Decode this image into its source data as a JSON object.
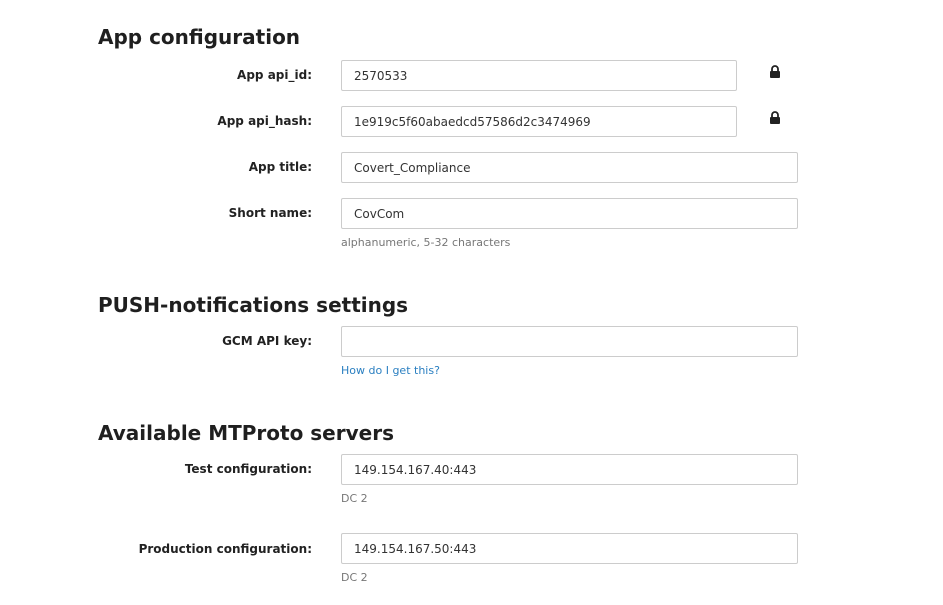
{
  "app_config": {
    "title": "App configuration",
    "api_id": {
      "label": "App api_id:",
      "value": "2570533",
      "locked_icon": "lock-icon"
    },
    "api_hash": {
      "label": "App api_hash:",
      "value": "1e919c5f60abaedcd57586d2c3474969",
      "locked_icon": "lock-icon"
    },
    "app_title": {
      "label": "App title:",
      "value": "Covert_Compliance"
    },
    "short_name": {
      "label": "Short name:",
      "value": "CovCom",
      "hint": "alphanumeric, 5-32 characters"
    }
  },
  "push": {
    "title": "PUSH-notifications settings",
    "gcm_key": {
      "label": "GCM API key:",
      "value": "",
      "help_link": "How do I get this?"
    }
  },
  "mtproto": {
    "title": "Available MTProto servers",
    "test": {
      "label": "Test configuration:",
      "value": "149.154.167.40:443",
      "dc": "DC 2"
    },
    "production": {
      "label": "Production configuration:",
      "value": "149.154.167.50:443",
      "dc": "DC 2"
    }
  },
  "colors": {
    "link": "#2a7fc1",
    "border": "#cccccc",
    "hint": "#777777"
  }
}
